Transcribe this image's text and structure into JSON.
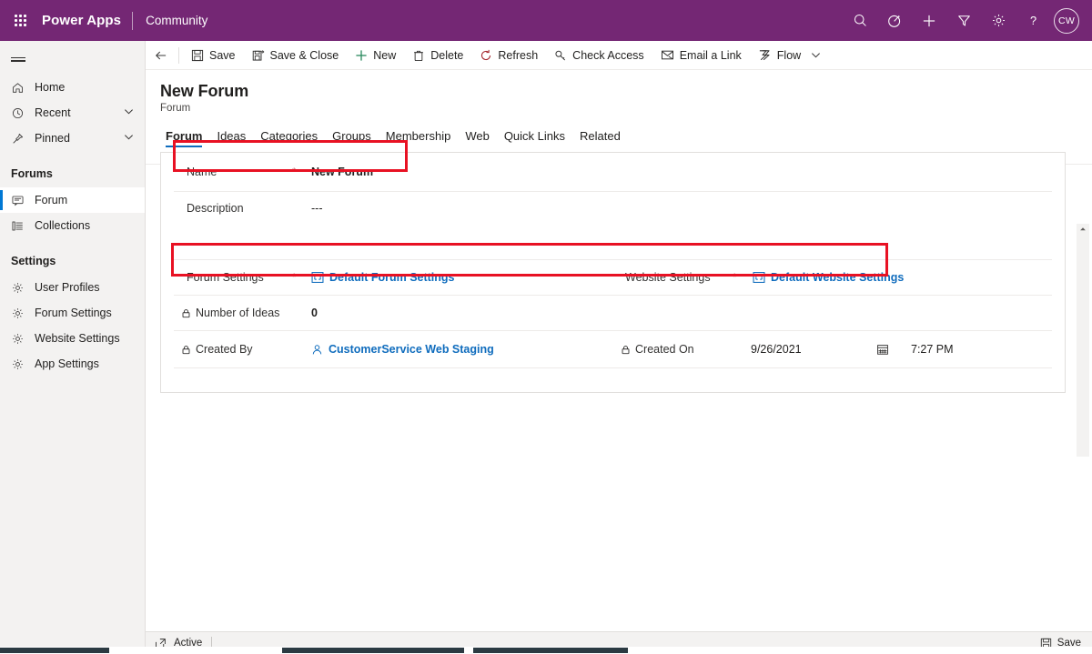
{
  "topbar": {
    "brand": "Power Apps",
    "app_name": "Community",
    "icons": [
      "waffle-icon",
      "search-icon",
      "assistant-icon",
      "add-icon",
      "filter-icon",
      "settings-icon",
      "help-icon"
    ],
    "avatar_initials": "CW",
    "accent_color": "#742774"
  },
  "sidebar": {
    "hamburger": "site-map-toggle",
    "items": [
      {
        "label": "Home",
        "icon": "home-icon",
        "expandable": false
      },
      {
        "label": "Recent",
        "icon": "clock-icon",
        "expandable": true
      },
      {
        "label": "Pinned",
        "icon": "pin-icon",
        "expandable": true
      }
    ],
    "groups": [
      {
        "title": "Forums",
        "items": [
          {
            "label": "Forum",
            "icon": "forum-icon",
            "selected": true
          },
          {
            "label": "Collections",
            "icon": "collections-icon",
            "selected": false
          }
        ]
      },
      {
        "title": "Settings",
        "items": [
          {
            "label": "User Profiles",
            "icon": "gear-icon",
            "selected": false
          },
          {
            "label": "Forum Settings",
            "icon": "gear-icon",
            "selected": false
          },
          {
            "label": "Website Settings",
            "icon": "gear-icon",
            "selected": false
          },
          {
            "label": "App Settings",
            "icon": "gear-icon",
            "selected": false
          }
        ]
      }
    ]
  },
  "commandbar": {
    "back": "back-arrow",
    "buttons": [
      {
        "label": "Save",
        "icon": "save-icon"
      },
      {
        "label": "Save & Close",
        "icon": "save-close-icon"
      },
      {
        "label": "New",
        "icon": "plus-icon"
      },
      {
        "label": "Delete",
        "icon": "trash-icon"
      },
      {
        "label": "Refresh",
        "icon": "refresh-icon"
      },
      {
        "label": "Check Access",
        "icon": "key-icon"
      },
      {
        "label": "Email a Link",
        "icon": "mail-icon"
      },
      {
        "label": "Flow",
        "icon": "flow-icon"
      }
    ],
    "overflow_caret": "chevron-down-icon"
  },
  "record": {
    "title": "New Forum",
    "subtitle": "Forum",
    "tabs": [
      {
        "label": "Forum",
        "active": true
      },
      {
        "label": "Ideas",
        "active": false
      },
      {
        "label": "Categories",
        "active": false
      },
      {
        "label": "Groups",
        "active": false
      },
      {
        "label": "Membership",
        "active": false
      },
      {
        "label": "Web",
        "active": false
      },
      {
        "label": "Quick Links",
        "active": false
      },
      {
        "label": "Related",
        "active": false
      }
    ]
  },
  "form": {
    "name": {
      "label": "Name",
      "required": "*",
      "value": "New Forum"
    },
    "description": {
      "label": "Description",
      "value": "---"
    },
    "forum_settings": {
      "label": "Forum Settings",
      "required": "*",
      "value": "Default Forum Settings",
      "icon": "entity-record-icon"
    },
    "website_settings": {
      "label": "Website Settings",
      "required": "*",
      "value": "Default Website Settings",
      "icon": "entity-record-icon"
    },
    "number_of_ideas": {
      "label": "Number of Ideas",
      "value": "0",
      "locked": true
    },
    "created_by": {
      "label": "Created By",
      "value": "CustomerService Web Staging",
      "locked": true,
      "icon": "person-icon"
    },
    "created_on": {
      "label": "Created On",
      "date": "9/26/2021",
      "time": "7:27 PM",
      "locked": true,
      "icon": "calendar-icon"
    }
  },
  "annotations": {
    "highlight_color": "#e81123",
    "boxes": [
      "name-field-highlight",
      "settings-row-highlight"
    ]
  },
  "statusbar": {
    "icon": "popout-icon",
    "state": "Active",
    "save_label": "Save",
    "save_icon": "save-icon"
  }
}
